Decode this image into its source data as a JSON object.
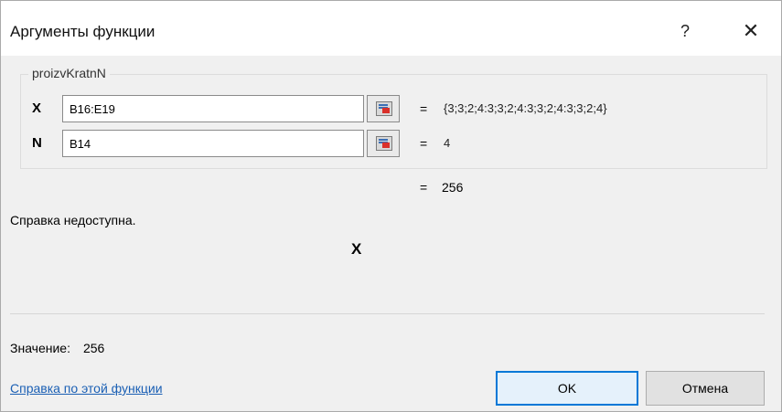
{
  "window": {
    "title": "Аргументы функции",
    "help_button": "?",
    "close_button": "✕"
  },
  "function": {
    "name": "proizvKratnN",
    "args": [
      {
        "label": "X",
        "value": "B16:E19",
        "equals": "=",
        "evaluated": "{3;3;2;4:3;3;2;4:3;3;2;4:3;3;2;4}"
      },
      {
        "label": "N",
        "value": "B14",
        "equals": "=",
        "evaluated": "4"
      }
    ],
    "result_equals": "=",
    "result": "256",
    "description": "Справка недоступна.",
    "arg_description_name": "X"
  },
  "footer": {
    "value_label": "Значение:",
    "value": "256",
    "help_link": "Справка по этой функции",
    "ok_label": "OK",
    "cancel_label": "Отмена"
  }
}
